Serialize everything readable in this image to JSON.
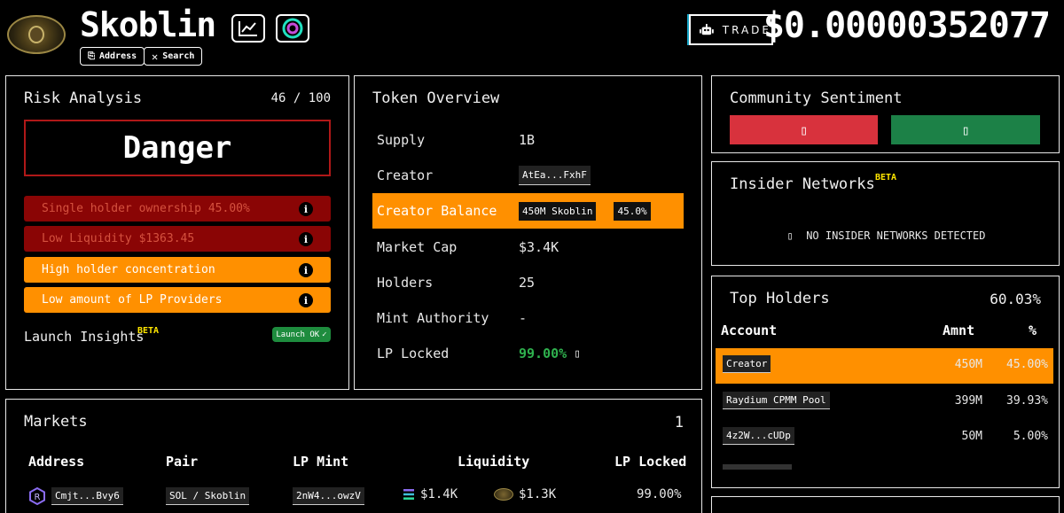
{
  "header": {
    "token_name": "Skoblin",
    "address_label": "Address",
    "search_label": "Search",
    "trade_label": "TRADE",
    "price": "$0.00000352077"
  },
  "risk": {
    "title": "Risk Analysis",
    "score": "46 / 100",
    "level": "Danger",
    "items": [
      {
        "text": "Single holder ownership 45.00%",
        "severity": "red"
      },
      {
        "text": "Low Liquidity $1363.45",
        "severity": "red"
      },
      {
        "text": "High holder concentration",
        "severity": "orange"
      },
      {
        "text": "Low amount of LP Providers",
        "severity": "orange"
      }
    ],
    "launch_insights_label": "Launch Insights",
    "beta_label": "BETA",
    "launch_ok_label": "Launch OK"
  },
  "overview": {
    "title": "Token Overview",
    "rows": {
      "supply_label": "Supply",
      "supply_value": "1B",
      "creator_label": "Creator",
      "creator_value": "AtEa...FxhF",
      "creator_balance_label": "Creator Balance",
      "creator_balance_value": "450M Skoblin",
      "creator_balance_pct": "45.0%",
      "market_cap_label": "Market Cap",
      "market_cap_value": "$3.4K",
      "holders_label": "Holders",
      "holders_value": "25",
      "mint_label": "Mint Authority",
      "mint_value": "-",
      "lp_locked_label": "LP Locked",
      "lp_locked_value": "99.00%"
    }
  },
  "community": {
    "title": "Community Sentiment",
    "colors": {
      "down": "#d8323d",
      "up": "#1c8147"
    }
  },
  "insiders": {
    "title": "Insider Networks",
    "beta_label": "BETA",
    "empty_text": "NO INSIDER NETWORKS DETECTED"
  },
  "holders": {
    "title": "Top Holders",
    "total_pct": "60.03%",
    "col_account": "Account",
    "col_amount": "Amnt",
    "col_pct": "%",
    "rows": [
      {
        "account": "Creator",
        "amount": "450M",
        "pct": "45.00%"
      },
      {
        "account": "Raydium CPMM Pool",
        "amount": "399M",
        "pct": "39.93%"
      },
      {
        "account": "4z2W...cUDp",
        "amount": "50M",
        "pct": "5.00%"
      }
    ]
  },
  "markets": {
    "title": "Markets",
    "count": "1",
    "col_address": "Address",
    "col_pair": "Pair",
    "col_lp_mint": "LP Mint",
    "col_liquidity": "Liquidity",
    "col_lp_locked": "LP Locked",
    "row": {
      "address": "Cmjt...Bvy6",
      "pair": "SOL / Skoblin",
      "lp_mint": "2nW4...owzV",
      "liquidity_sol": "$1.4K",
      "liquidity_token": "$1.3K",
      "lp_locked": "99.00%"
    }
  },
  "colors": {
    "accent_orange": "#ff9000",
    "danger_red": "#8a0505",
    "ok_green": "#1e8c3e",
    "beta_yellow": "#ffe600"
  }
}
